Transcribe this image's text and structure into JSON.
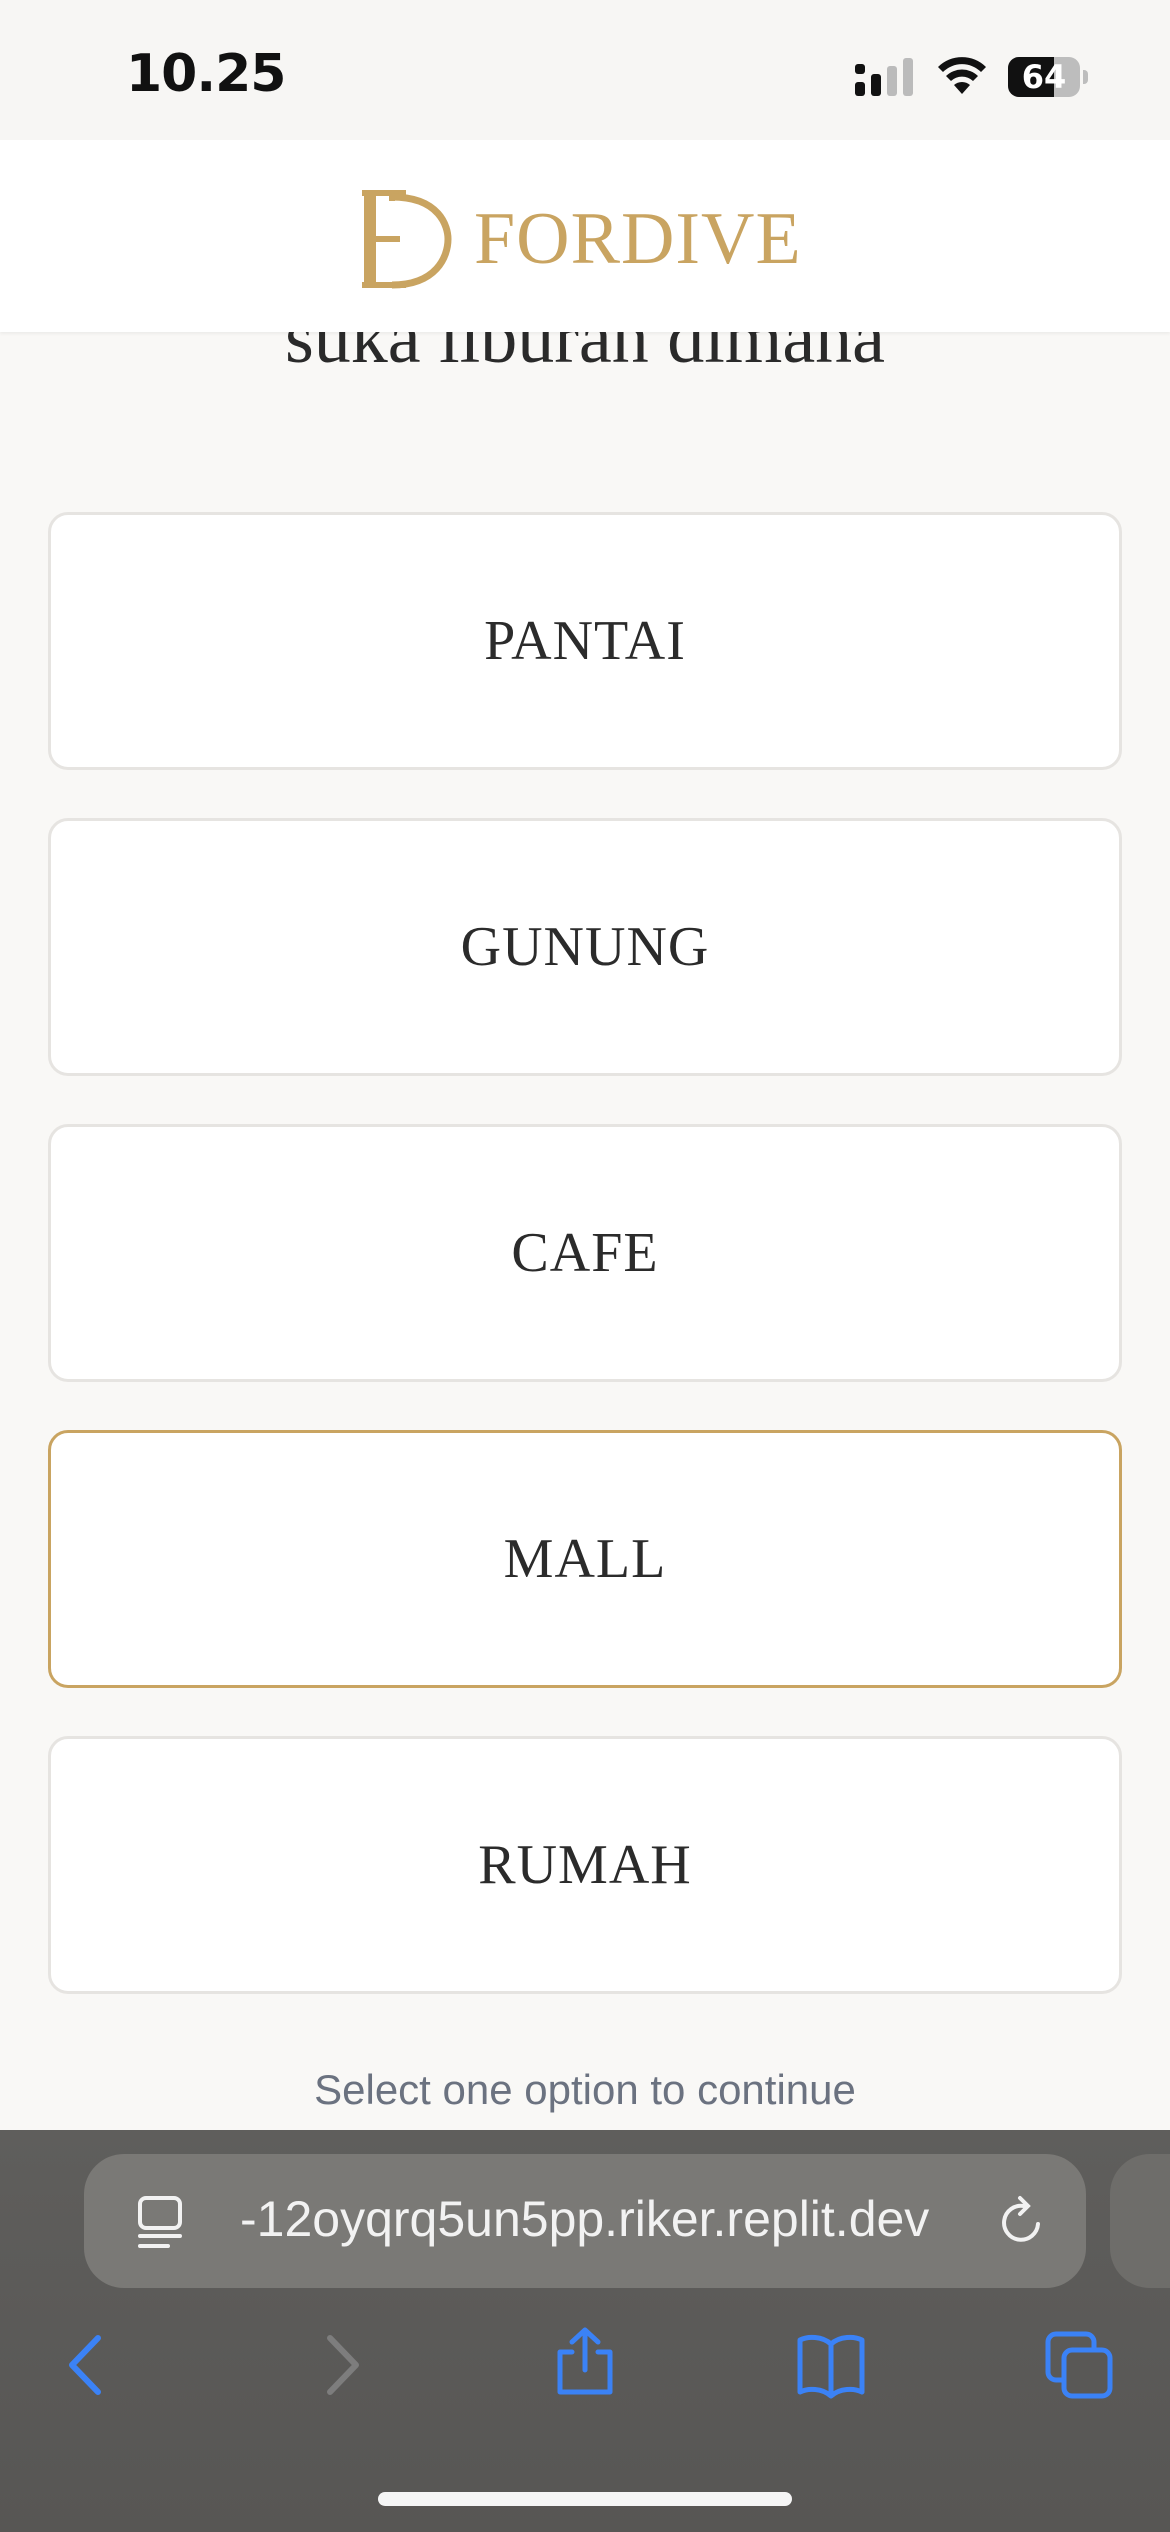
{
  "status_bar": {
    "time": "10.25",
    "battery_level": "64",
    "battery_fraction": 0.64
  },
  "header": {
    "logo_text": "FORDIVE",
    "brand_color": "#c9a461"
  },
  "quiz": {
    "question": "suka liburan dimana",
    "options": [
      {
        "label": "PANTAI",
        "selected": false
      },
      {
        "label": "GUNUNG",
        "selected": false
      },
      {
        "label": "CAFE",
        "selected": false
      },
      {
        "label": "MALL",
        "selected": true
      },
      {
        "label": "RUMAH",
        "selected": false
      }
    ],
    "hint": "Select one option to continue"
  },
  "browser": {
    "url": "-12oyqrq5un5pp.riker.replit.dev",
    "icons": [
      "reader-icon",
      "reload-icon",
      "back-icon",
      "forward-icon",
      "share-icon",
      "bookmarks-icon",
      "tabs-icon"
    ],
    "accent_color": "#3b82f6"
  }
}
